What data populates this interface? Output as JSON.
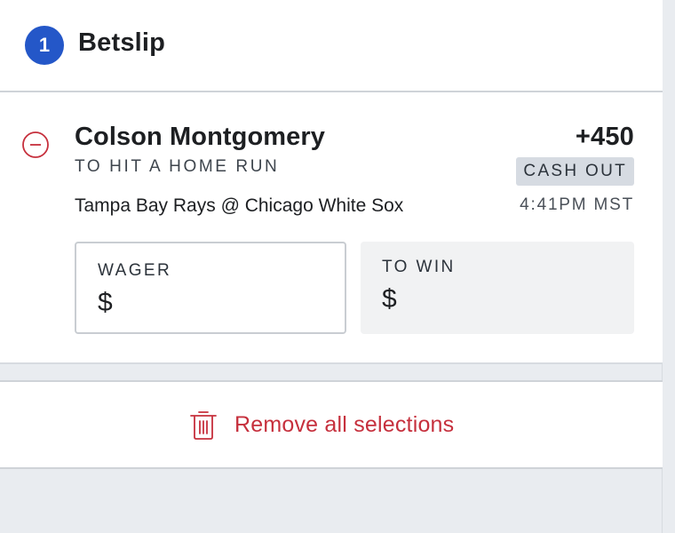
{
  "header": {
    "count": "1",
    "title": "Betslip"
  },
  "bet": {
    "player": "Colson Montgomery",
    "market": "TO HIT A HOME RUN",
    "odds": "+450",
    "cashout_label": "CASH OUT",
    "matchup": "Tampa Bay Rays @ Chicago White Sox",
    "time": "4:41PM MST",
    "remove_icon": "minus-circle-icon",
    "wager": {
      "label": "WAGER",
      "currency": "$",
      "value": ""
    },
    "to_win": {
      "label": "TO WIN",
      "currency": "$",
      "value": ""
    }
  },
  "actions": {
    "remove_all_label": "Remove all selections",
    "remove_all_icon": "trash-icon"
  },
  "colors": {
    "brand": "#2457c8",
    "danger": "#c6303d",
    "text": "#1d1f22",
    "muted": "#3e454d",
    "background": "#e9ecf0"
  }
}
